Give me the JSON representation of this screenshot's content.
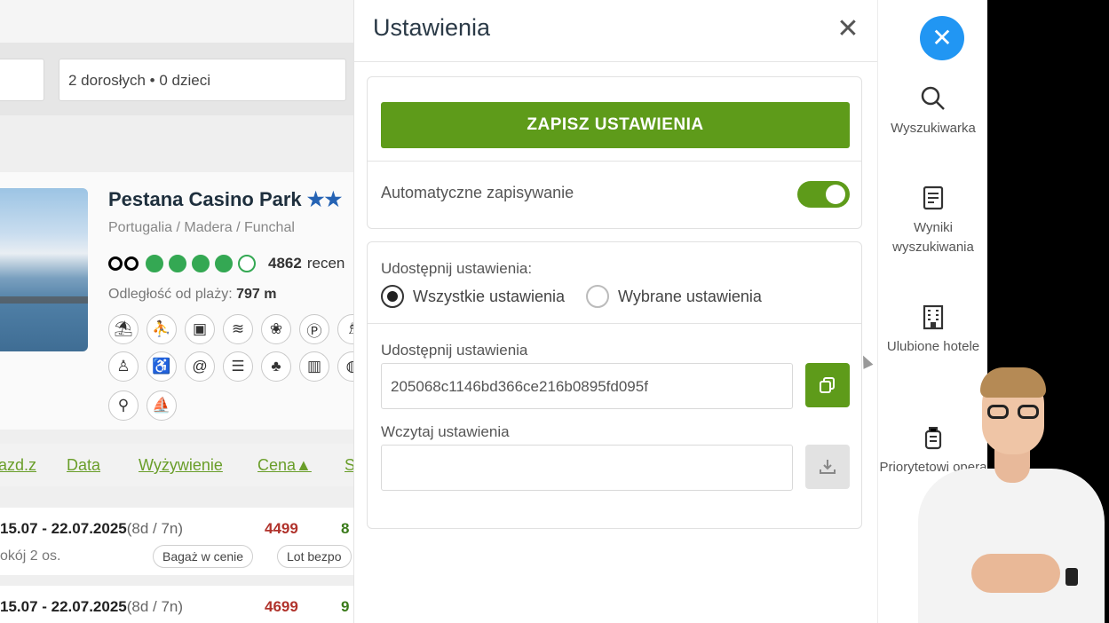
{
  "background_page": {
    "guests_field": "2 dorosłych • 0 dzieci",
    "hotel": {
      "name": "Pestana Casino Park",
      "stars": "★★",
      "location": "Portugalia / Madera / Funchal",
      "reviews_count": "4862",
      "reviews_suffix": "recen",
      "rating_dots": 4,
      "distance_label": "Odległość od plaży:",
      "distance_value": "797 m"
    },
    "sort_links": [
      "azd.z",
      "Data",
      "Wyżywienie",
      "Cena▲",
      "S"
    ],
    "offers": [
      {
        "dates": "15.07 - 22.07.2025",
        "duration": "(8d / 7n)",
        "price": "4499",
        "price2": "8",
        "room": "okój 2 os.",
        "pills": [
          "Bagaż w cenie",
          "Lot bezpo"
        ]
      },
      {
        "dates": "15.07 - 22.07.2025",
        "duration": "(8d / 7n)",
        "price": "4699",
        "price2": "9"
      }
    ]
  },
  "settings": {
    "title": "Ustawienia",
    "close": "✕",
    "save_button": "ZAPISZ USTAWIENIA",
    "autosave_label": "Automatyczne zapisywanie",
    "autosave_on": true,
    "share_header": "Udostępnij ustawienia:",
    "radio_all": "Wszystkie ustawienia",
    "radio_selected": "Wybrane ustawienia",
    "share_field_label": "Udostępnij ustawienia",
    "share_code": "205068c1146bd366ce216b0895fd095f",
    "load_field_label": "Wczytaj ustawienia",
    "load_placeholder": ""
  },
  "nav": {
    "close": "✕",
    "items": [
      {
        "icon": "search-icon",
        "label": "Wyszukiwarka"
      },
      {
        "icon": "results-icon",
        "label": "Wyniki wyszukiwania"
      },
      {
        "icon": "hotel-icon",
        "label": "Ulubione hotele"
      },
      {
        "icon": "suitcase-icon",
        "label": "Priorytetowi opera"
      }
    ]
  },
  "colors": {
    "accent_green": "#5e9b1a",
    "fab_blue": "#2196f3",
    "price_red": "#b0322b"
  }
}
